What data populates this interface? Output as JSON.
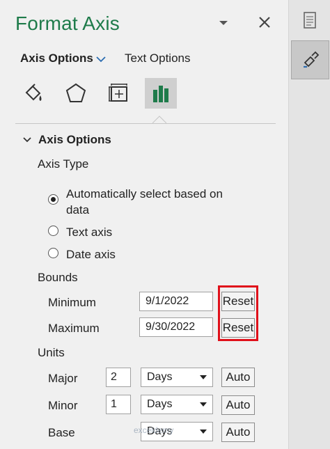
{
  "panel": {
    "title": "Format Axis",
    "tabs": [
      {
        "label": "Axis Options",
        "active": true
      },
      {
        "label": "Text Options",
        "active": false
      }
    ],
    "category_icons": [
      "fill-line-icon",
      "effects-pentagon-icon",
      "size-properties-icon",
      "axis-options-bar-chart-icon"
    ]
  },
  "section": {
    "title": "Axis Options",
    "axis_type_label": "Axis Type",
    "radios": [
      {
        "label": "Automatically select based on",
        "label2": "data",
        "checked": true
      },
      {
        "label": "Text axis",
        "checked": false
      },
      {
        "label": "Date axis",
        "checked": false
      }
    ],
    "bounds_label": "Bounds",
    "bounds": {
      "minimum_label": "Minimum",
      "minimum_value": "9/1/2022",
      "maximum_label": "Maximum",
      "maximum_value": "9/30/2022",
      "reset_label": "Reset"
    },
    "units_label": "Units",
    "units": {
      "major_label": "Major",
      "major_value": "2",
      "major_unit": "Days",
      "minor_label": "Minor",
      "minor_value": "1",
      "minor_unit": "Days",
      "base_label": "Base",
      "base_unit": "Days",
      "auto_label": "Auto"
    }
  },
  "watermark": "exceldemy",
  "colors": {
    "title": "#1e7b4a",
    "highlight": "#e0101a"
  }
}
